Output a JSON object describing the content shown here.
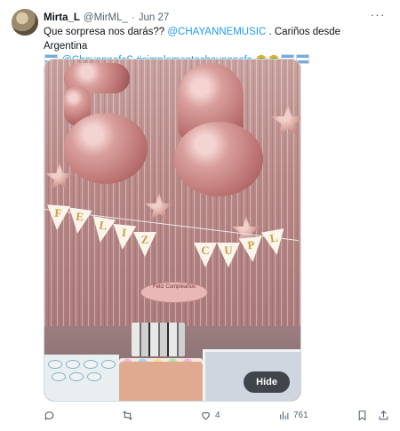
{
  "tweet": {
    "author_name": "Mirta_L",
    "author_handle": "@MirML_",
    "separator": "·",
    "date": "Jun 27",
    "more_label": "···",
    "text_part1": "Que sorpresa nos darás?? ",
    "mention1": "@CHAYANNEMUSIC",
    "text_part2": " . Cariños desde Argentina",
    "mention2": "@ChayannefcS",
    "hashtag": "#simplementechayannefc"
  },
  "media": {
    "balloon_number": "56",
    "banner_letters": [
      "F",
      "E",
      "L",
      "I",
      "Z",
      "C",
      "U",
      "P",
      "L"
    ],
    "plaque_text": "Feliz Cumpleaños",
    "hide_label": "Hide"
  },
  "actions": {
    "reply_count": "",
    "retweet_count": "",
    "like_count": "4",
    "views_count": "761"
  },
  "icons": [
    "more-icon",
    "reply-icon",
    "retweet-icon",
    "like-icon",
    "views-icon",
    "bookmark-icon",
    "share-icon"
  ],
  "colors": {
    "link": "#1d9bf0",
    "muted": "#536471",
    "text": "#0f1419"
  }
}
